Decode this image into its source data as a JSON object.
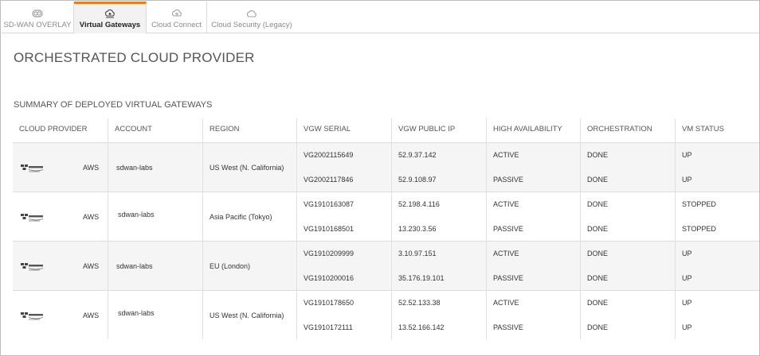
{
  "tabs": [
    {
      "label": "SD-WAN OVERLAY",
      "icon": "overlay-icon",
      "active": false
    },
    {
      "label": "Virtual Gateways",
      "icon": "virtual-gateway-icon",
      "active": true
    },
    {
      "label": "Cloud Connect",
      "icon": "cloud-connect-icon",
      "active": false
    },
    {
      "label": "Cloud Security (Legacy)",
      "icon": "cloud-icon",
      "active": false
    }
  ],
  "page_title": "ORCHESTRATED CLOUD PROVIDER",
  "section_title": "SUMMARY OF DEPLOYED VIRTUAL GATEWAYS",
  "table": {
    "headers": [
      "CLOUD PROVIDER",
      "ACCOUNT",
      "REGION",
      "VGW SERIAL",
      "VGW PUBLIC IP",
      "HIGH AVAILABILITY",
      "ORCHESTRATION",
      "VM STATUS"
    ],
    "groups": [
      {
        "provider_logo": "amazon-web-services-logo",
        "provider": "AWS",
        "account": "sdwan-labs",
        "region": "US West (N. California)",
        "gateways": [
          {
            "serial": "VG2002115649",
            "ip": "52.9.37.142",
            "ha": "ACTIVE",
            "orchestration": "DONE",
            "vm_status": "UP"
          },
          {
            "serial": "VG2002117846",
            "ip": "52.9.108.97",
            "ha": "PASSIVE",
            "orchestration": "DONE",
            "vm_status": "UP"
          }
        ]
      },
      {
        "provider_logo": "amazon-web-services-logo",
        "provider": "AWS",
        "account": "sdwan-labs",
        "region": "Asia Pacific (Tokyo)",
        "gateways": [
          {
            "serial": "VG1910163087",
            "ip": "52.198.4.116",
            "ha": "ACTIVE",
            "orchestration": "DONE",
            "vm_status": "STOPPED"
          },
          {
            "serial": "VG1910168501",
            "ip": "13.230.3.56",
            "ha": "PASSIVE",
            "orchestration": "DONE",
            "vm_status": "STOPPED"
          }
        ]
      },
      {
        "provider_logo": "amazon-web-services-logo",
        "provider": "AWS",
        "account": "sdwan-labs",
        "region": "EU (London)",
        "gateways": [
          {
            "serial": "VG1910209999",
            "ip": "3.10.97.151",
            "ha": "ACTIVE",
            "orchestration": "DONE",
            "vm_status": "UP"
          },
          {
            "serial": "VG1910200016",
            "ip": "35.176.19.101",
            "ha": "PASSIVE",
            "orchestration": "DONE",
            "vm_status": "UP"
          }
        ]
      },
      {
        "provider_logo": "amazon-web-services-logo",
        "provider": "AWS",
        "account": "sdwan-labs",
        "region": "US West (N. California)",
        "gateways": [
          {
            "serial": "VG1910178650",
            "ip": "52.52.133.38",
            "ha": "ACTIVE",
            "orchestration": "DONE",
            "vm_status": "UP"
          },
          {
            "serial": "VG1910172111",
            "ip": "13.52.166.142",
            "ha": "PASSIVE",
            "orchestration": "DONE",
            "vm_status": "UP"
          }
        ]
      }
    ]
  },
  "colors": {
    "accent": "#f07c22",
    "row_shade": "#f5f5f5",
    "border": "#dcdcdc"
  }
}
